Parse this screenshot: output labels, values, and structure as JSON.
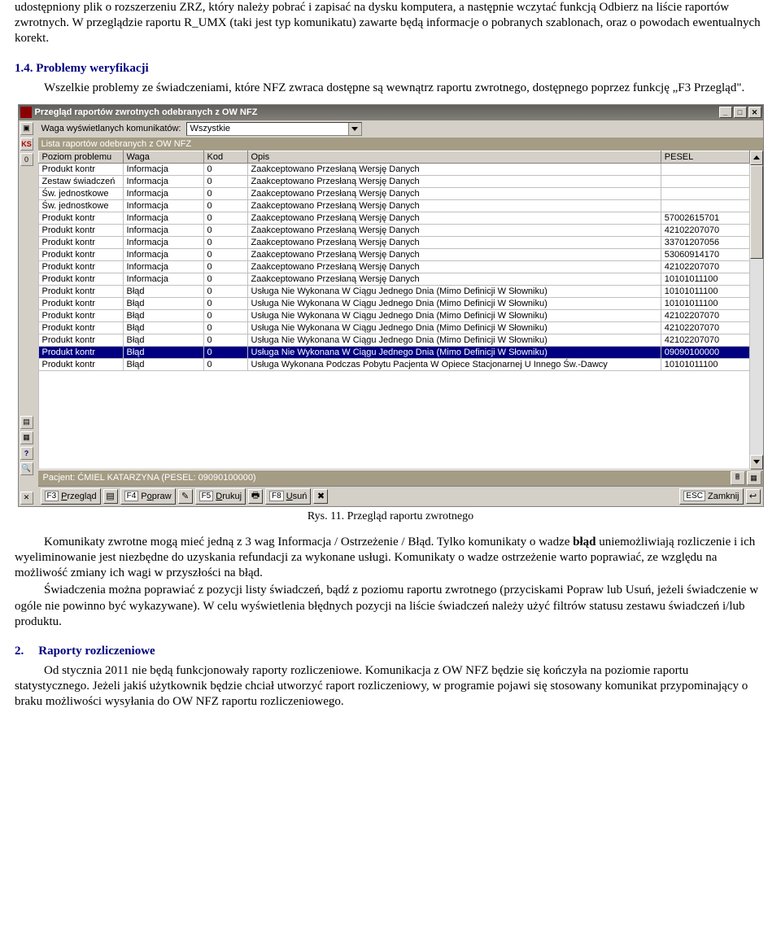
{
  "paras": {
    "p1": "udostępniony plik o rozszerzeniu ZRZ, który należy pobrać i zapisać na dysku komputera, a następnie wczytać funkcją Odbierz na liście raportów zwrotnych. W przeglądzie raportu R_UMX (taki jest typ komunikatu) zawarte będą informacje o pobranych szablonach, oraz o powodach ewentualnych korekt.",
    "h1": "1.4.  Problemy weryfikacji",
    "p2": "Wszelkie problemy ze świadczeniami, które NFZ zwraca dostępne są wewnątrz raportu zwrotnego, dostępnego poprzez funkcję „F3 Przegląd\".",
    "caption": "Rys. 11. Przegląd raportu zwrotnego",
    "p3a": "Komunikaty zwrotne mogą mieć jedną z 3 wag Informacja / Ostrzeżenie / Błąd. Tylko komunikaty o wadze ",
    "p3b": "błąd",
    "p3c": " uniemożliwiają rozliczenie i ich wyeliminowanie jest niezbędne do uzyskania refundacji za wykonane usługi. Komunikaty o wadze ostrzeżenie warto poprawiać, ze względu na możliwość zmiany ich wagi w przyszłości na błąd.",
    "p4": "Świadczenia można poprawiać z pozycji listy świadczeń, bądź z poziomu raportu zwrotnego (przyciskami Popraw lub Usuń, jeżeli świadczenie w ogóle nie powinno być wykazywane). W celu wyświetlenia błędnych pozycji na liście świadczeń należy użyć filtrów statusu zestawu świadczeń i/lub produktu.",
    "h2n": "2.",
    "h2t": "Raporty rozliczeniowe",
    "p5": "Od stycznia 2011 nie będą funkcjonowały raporty rozliczeniowe. Komunikacja z OW NFZ będzie się kończyła na poziomie raportu statystycznego. Jeżeli jakiś użytkownik będzie chciał utworzyć raport rozliczeniowy, w programie pojawi się stosowany komunikat przypominający o braku możliwości wysyłania do OW NFZ raportu rozliczeniowego."
  },
  "win": {
    "title": "Przegląd raportów zwrotnych odebranych z OW NFZ",
    "filterLabel": "Waga wyświetlanych komunikatów:",
    "filterValue": "Wszystkie",
    "listLabel": "Lista raportów odebranych z OW NFZ",
    "status": "Pacjent: ĆMIEL KATARZYNA (PESEL: 09090100000)",
    "headers": {
      "poziom": "Poziom problemu",
      "waga": "Waga",
      "kod": "Kod",
      "opis": "Opis",
      "pesel": "PESEL"
    },
    "fn": {
      "f3": "Przegląd",
      "f4": "Popraw",
      "f5": "Drukuj",
      "f8": "Usuń",
      "esc": "Zamknij"
    },
    "railIcons": {
      "ks": "KS",
      "zero": "0",
      "q": "?",
      "x": "✕"
    },
    "rows": [
      {
        "poziom": "Produkt kontr",
        "waga": "Informacja",
        "kod": "0",
        "opis": "Zaakceptowano Przesłaną Wersję Danych",
        "pesel": ""
      },
      {
        "poziom": "Zestaw świadczeń",
        "waga": "Informacja",
        "kod": "0",
        "opis": "Zaakceptowano Przesłaną Wersję Danych",
        "pesel": ""
      },
      {
        "poziom": "Św. jednostkowe",
        "waga": "Informacja",
        "kod": "0",
        "opis": "Zaakceptowano Przesłaną Wersję Danych",
        "pesel": ""
      },
      {
        "poziom": "Św. jednostkowe",
        "waga": "Informacja",
        "kod": "0",
        "opis": "Zaakceptowano Przesłaną Wersję Danych",
        "pesel": ""
      },
      {
        "poziom": "Produkt kontr",
        "waga": "Informacja",
        "kod": "0",
        "opis": "Zaakceptowano Przesłaną Wersję Danych",
        "pesel": "57002615701"
      },
      {
        "poziom": "Produkt kontr",
        "waga": "Informacja",
        "kod": "0",
        "opis": "Zaakceptowano Przesłaną Wersję Danych",
        "pesel": "42102207070"
      },
      {
        "poziom": "Produkt kontr",
        "waga": "Informacja",
        "kod": "0",
        "opis": "Zaakceptowano Przesłaną Wersję Danych",
        "pesel": "33701207056"
      },
      {
        "poziom": "Produkt kontr",
        "waga": "Informacja",
        "kod": "0",
        "opis": "Zaakceptowano Przesłaną Wersję Danych",
        "pesel": "53060914170"
      },
      {
        "poziom": "Produkt kontr",
        "waga": "Informacja",
        "kod": "0",
        "opis": "Zaakceptowano Przesłaną Wersję Danych",
        "pesel": "42102207070"
      },
      {
        "poziom": "Produkt kontr",
        "waga": "Informacja",
        "kod": "0",
        "opis": "Zaakceptowano Przesłaną Wersję Danych",
        "pesel": "10101011100"
      },
      {
        "poziom": "Produkt kontr",
        "waga": "Błąd",
        "kod": "0",
        "opis": "Usługa Nie Wykonana W Ciągu Jednego Dnia (Mimo Definicji W Słowniku)",
        "pesel": "10101011100"
      },
      {
        "poziom": "Produkt kontr",
        "waga": "Błąd",
        "kod": "0",
        "opis": "Usługa Nie Wykonana W Ciągu Jednego Dnia (Mimo Definicji W Słowniku)",
        "pesel": "10101011100"
      },
      {
        "poziom": "Produkt kontr",
        "waga": "Błąd",
        "kod": "0",
        "opis": "Usługa Nie Wykonana W Ciągu Jednego Dnia (Mimo Definicji W Słowniku)",
        "pesel": "42102207070"
      },
      {
        "poziom": "Produkt kontr",
        "waga": "Błąd",
        "kod": "0",
        "opis": "Usługa Nie Wykonana W Ciągu Jednego Dnia (Mimo Definicji W Słowniku)",
        "pesel": "42102207070"
      },
      {
        "poziom": "Produkt kontr",
        "waga": "Błąd",
        "kod": "0",
        "opis": "Usługa Nie Wykonana W Ciągu Jednego Dnia (Mimo Definicji W Słowniku)",
        "pesel": "42102207070"
      },
      {
        "poziom": "Produkt kontr",
        "waga": "Błąd",
        "kod": "0",
        "opis": "Usługa Nie Wykonana W Ciągu Jednego Dnia (Mimo Definicji W Słowniku)",
        "pesel": "09090100000",
        "sel": true
      },
      {
        "poziom": "Produkt kontr",
        "waga": "Błąd",
        "kod": "0",
        "opis": "Usługa Wykonana Podczas Pobytu Pacjenta W Opiece Stacjonarnej U Innego Św.-Dawcy",
        "pesel": "10101011100"
      }
    ]
  }
}
